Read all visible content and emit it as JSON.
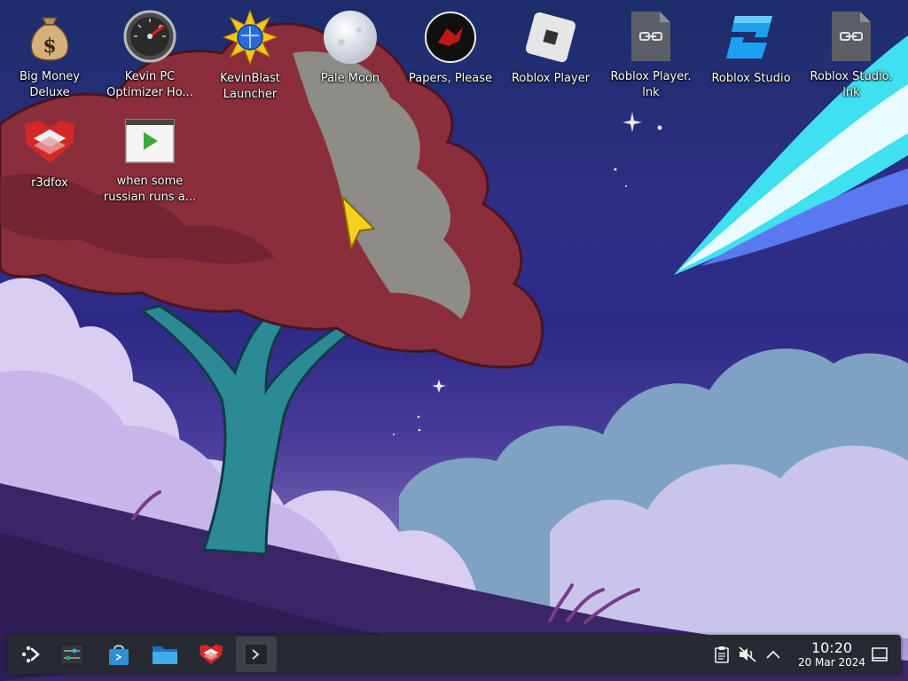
{
  "desktop_icons": [
    {
      "label": "Big Money Deluxe",
      "icon": "money-bag-icon"
    },
    {
      "label": "Kevin PC Optimizer Ho...",
      "icon": "speedometer-icon"
    },
    {
      "label": "KevinBlast Launcher",
      "icon": "starburst-globe-icon"
    },
    {
      "label": "Pale Moon",
      "icon": "moon-icon"
    },
    {
      "label": "Papers, Please",
      "icon": "papers-please-icon"
    },
    {
      "label": "Roblox Player",
      "icon": "roblox-icon"
    },
    {
      "label": "Roblox Player.\nlnk",
      "icon": "link-file-icon"
    },
    {
      "label": "Roblox Studio",
      "icon": "roblox-studio-icon"
    },
    {
      "label": "Roblox Studio.\nlnk",
      "icon": "link-file-icon"
    },
    {
      "label": "r3dfox",
      "icon": "r3dfox-icon"
    },
    {
      "label": "when some russian runs a...",
      "icon": "video-file-icon"
    }
  ],
  "taskbar": {
    "items": [
      {
        "name": "application-launcher",
        "icon": "kde-launcher-icon"
      },
      {
        "name": "system-settings",
        "icon": "settings-sliders-icon"
      },
      {
        "name": "discover-store",
        "icon": "store-bag-icon"
      },
      {
        "name": "dolphin-file-manager",
        "icon": "folder-icon"
      },
      {
        "name": "r3dfox-browser",
        "icon": "r3dfox-icon"
      },
      {
        "name": "konsole-terminal",
        "icon": "terminal-icon"
      }
    ],
    "tray": {
      "icons": [
        "clipboard-icon",
        "volume-muted-icon",
        "chevron-up-icon",
        "show-desktop-icon"
      ],
      "time": "10:20",
      "date": "20 Mar 2024"
    }
  },
  "colors": {
    "panel": "#272a31",
    "accent": "#3daee9",
    "tree_canopy": "#8b2e3c"
  }
}
